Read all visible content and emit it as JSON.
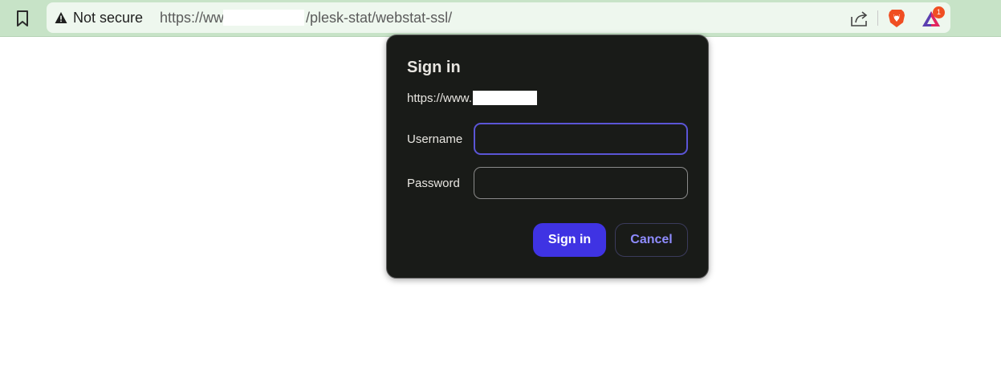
{
  "browser": {
    "security_text": "Not secure",
    "url_prefix": "https://www",
    "url_suffix": "/plesk-stat/webstat-ssl/",
    "rewards_badge_count": "1",
    "colors": {
      "toolbar_bg": "#c7e3c7",
      "omnibox_bg": "#eef7ee",
      "brave_orange": "#f04e22"
    },
    "icons": [
      "bookmark-icon",
      "warning-icon",
      "share-icon",
      "brave-shields-icon",
      "brave-rewards-icon"
    ]
  },
  "dialog": {
    "title": "Sign in",
    "origin_prefix": "https://www.",
    "username_label": "Username",
    "username_value": "",
    "password_label": "Password",
    "password_value": "",
    "signin_label": "Sign in",
    "cancel_label": "Cancel",
    "colors": {
      "background": "#191b18",
      "primary_button": "#3f33e3",
      "focus_border": "#5b55d6",
      "cancel_text": "#8f8cff"
    }
  }
}
